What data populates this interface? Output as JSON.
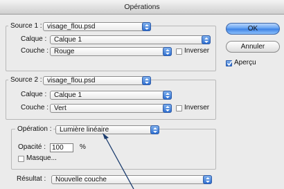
{
  "dialog": {
    "title": "Opérations"
  },
  "source1": {
    "label": "Source 1 :",
    "file": "visage_flou.psd",
    "layer_label": "Calque :",
    "layer": "Calque 1",
    "channel_label": "Couche :",
    "channel": "Rouge",
    "invert_label": "Inverser",
    "invert_checked": false
  },
  "source2": {
    "label": "Source 2 :",
    "file": "visage_flou.psd",
    "layer_label": "Calque :",
    "layer": "Calque 1",
    "channel_label": "Couche :",
    "channel": "Vert",
    "invert_label": "Inverser",
    "invert_checked": false
  },
  "operation": {
    "label": "Opération :",
    "mode": "Lumière linéaire",
    "opacity_label": "Opacité :",
    "opacity_value": "100",
    "opacity_unit": "%",
    "mask_label": "Masque...",
    "mask_checked": false
  },
  "result": {
    "label": "Résultat :",
    "value": "Nouvelle couche"
  },
  "buttons": {
    "ok": "OK",
    "cancel": "Annuler"
  },
  "preview": {
    "label": "Aperçu",
    "checked": true
  },
  "icons": {
    "popup": "up-down-arrows-icon",
    "check": "checkmark-icon"
  },
  "colors": {
    "accent": "#3a7fe3",
    "annotation_arrow": "#1b3c6e"
  }
}
